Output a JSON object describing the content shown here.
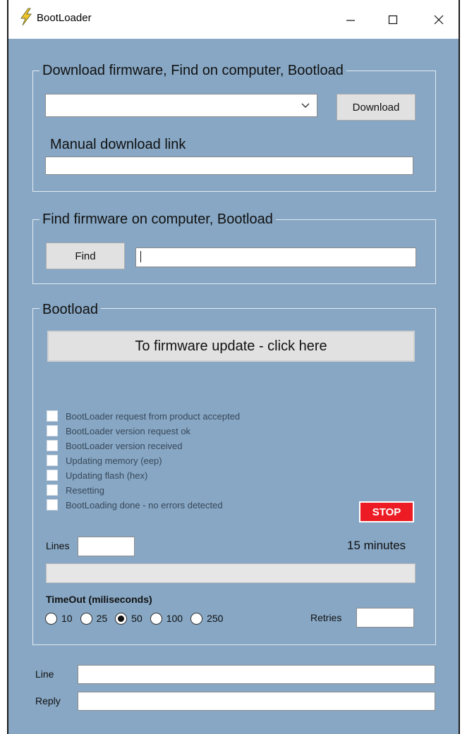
{
  "window": {
    "title": "BootLoader",
    "icon": "lightning-icon",
    "controls": [
      "minimize-icon",
      "maximize-icon",
      "close-icon"
    ]
  },
  "download_group": {
    "legend": "Download firmware, Find on computer, Bootload",
    "firmware_select_value": "",
    "download_button": "Download",
    "manual_link_label": "Manual download link",
    "manual_link_value": ""
  },
  "find_group": {
    "legend": "Find firmware on computer, Bootload",
    "find_button": "Find",
    "path_value": ""
  },
  "bootload_group": {
    "legend": "Bootload",
    "update_button": "To firmware update - click here",
    "checklist": [
      {
        "label": "BootLoader request from product accepted",
        "checked": false
      },
      {
        "label": "BootLoader version request ok",
        "checked": false
      },
      {
        "label": "BootLoader version received",
        "checked": false
      },
      {
        "label": "Updating memory (eep)",
        "checked": false
      },
      {
        "label": "Updating flash (hex)",
        "checked": false
      },
      {
        "label": "Resetting",
        "checked": false
      },
      {
        "label": "BootLoading done - no errors detected",
        "checked": false
      }
    ],
    "stop_button": "STOP",
    "lines_label": "Lines",
    "lines_value": "",
    "duration_text": "15 minutes",
    "progress": 0,
    "timeout_label": "TimeOut (miliseconds)",
    "timeout_options": [
      "10",
      "25",
      "50",
      "100",
      "250"
    ],
    "timeout_selected": "50",
    "retries_label": "Retries",
    "retries_value": ""
  },
  "footer": {
    "line_label": "Line",
    "line_value": "",
    "reply_label": "Reply",
    "reply_value": ""
  },
  "colors": {
    "background": "#87a7c4",
    "stop_red": "#ed1c24",
    "group_border": "#e3ebf2"
  }
}
